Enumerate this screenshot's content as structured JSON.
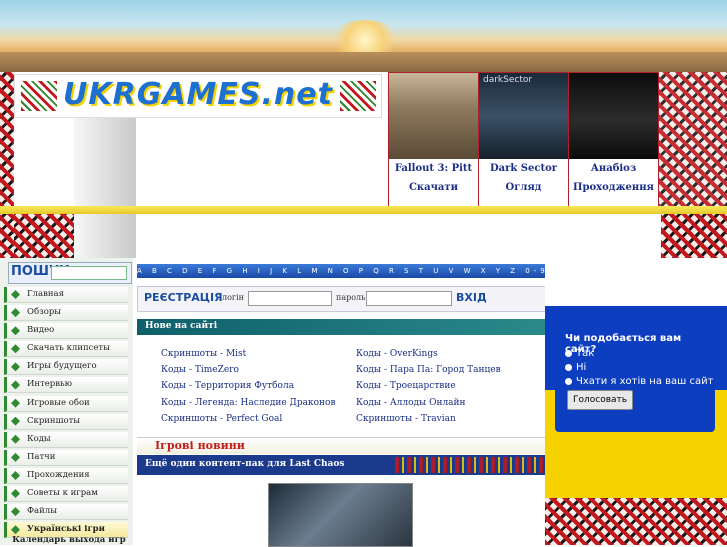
{
  "logo": {
    "text": "UKRGAMES.net"
  },
  "promos": [
    {
      "title": "Fallout 3: Pitt",
      "action": "Скачати"
    },
    {
      "title": "Dark Sector",
      "action": "Огляд",
      "image_caption": "darkSector"
    },
    {
      "title": "Анабіоз",
      "action": "Проходження"
    }
  ],
  "search": {
    "label": "ПОШУК"
  },
  "letters": "A B C D E F G H I J K L M N O P Q R S T U V W X Y Z 0-9 A",
  "login": {
    "register_label": "РЕЄСТРАЦІЯ",
    "login_label": "логін",
    "password_label": "пароль",
    "enter_label": "ВХІД"
  },
  "menu": [
    {
      "label": "Главная"
    },
    {
      "label": "Обзоры"
    },
    {
      "label": "Видео"
    },
    {
      "label": "Скачать клипсеты"
    },
    {
      "label": "Игры будущего"
    },
    {
      "label": "Интервью"
    },
    {
      "label": "Игровые обои"
    },
    {
      "label": "Скриншоты"
    },
    {
      "label": "Коды"
    },
    {
      "label": "Патчи"
    },
    {
      "label": "Прохождения"
    },
    {
      "label": "Советы к играм"
    },
    {
      "label": "Файлы"
    },
    {
      "label": "Українські ігри"
    }
  ],
  "calendar_label": "Календарь выхода игр",
  "new_on_site": {
    "header": "Нове на сайті",
    "left": [
      "Скриншоты - Mist",
      "Коды - TimeZero",
      "Коды - Территория Футбола",
      "Коды - Легенда: Наследие Драконов",
      "Скриншоты - Perfect Goal"
    ],
    "right": [
      "Коды - OverKings",
      "Коды - Пара Па: Город Танцев",
      "Коды - Троецарствие",
      "Коды - Аллоды Онлайн",
      "Скриншоты - Travian"
    ]
  },
  "games_news": {
    "header": "Ігрові новини",
    "item_title": "Ещё один контент-пак для Last Chaos"
  },
  "poll": {
    "question": "Чи подобається вам сайт?",
    "options": [
      "Так",
      "Ні",
      "Чхати я хотів на ваш сайт"
    ],
    "button": "Голосовать"
  }
}
